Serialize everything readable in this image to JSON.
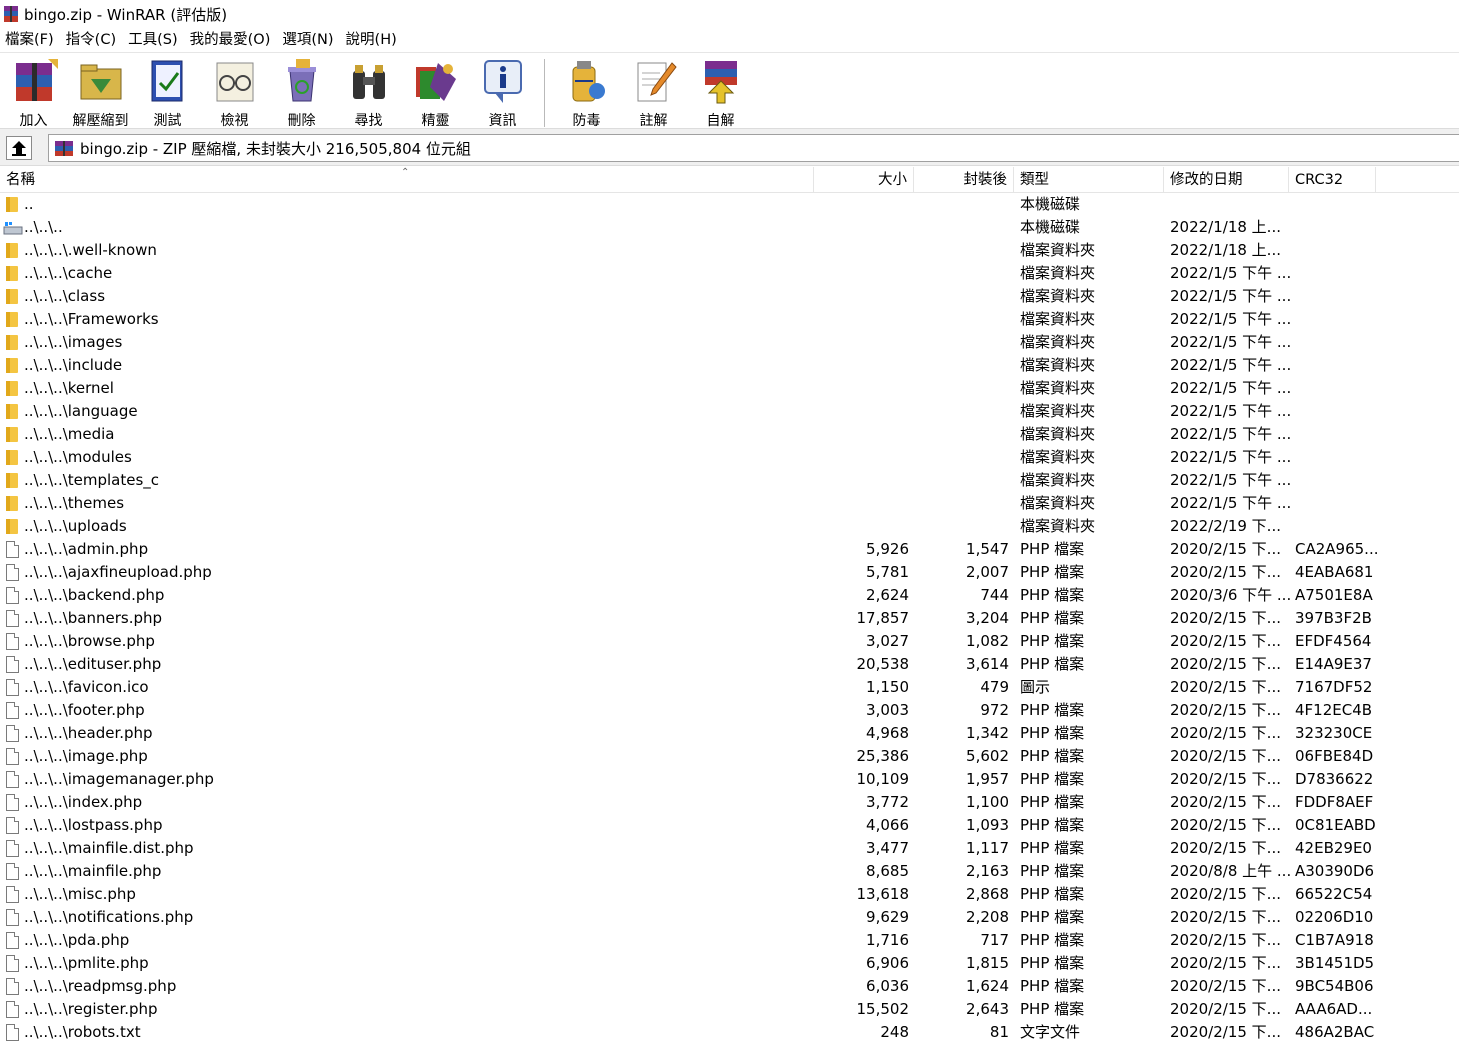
{
  "window": {
    "title": "bingo.zip - WinRAR (評估版)"
  },
  "menu": [
    "檔案(F)",
    "指令(C)",
    "工具(S)",
    "我的最愛(O)",
    "選項(N)",
    "說明(H)"
  ],
  "toolbar": {
    "add": "加入",
    "extract_to": "解壓縮到",
    "test": "測試",
    "view": "檢視",
    "delete": "刪除",
    "find": "尋找",
    "wizard": "精靈",
    "info": "資訊",
    "virus_scan": "防毒",
    "comment": "註解",
    "sfx": "自解"
  },
  "address": {
    "text": "bingo.zip - ZIP 壓縮檔, 未封裝大小 216,505,804 位元組"
  },
  "columns": {
    "name": "名稱",
    "size": "大小",
    "packed": "封裝後",
    "type": "類型",
    "modified": "修改的日期",
    "crc": "CRC32"
  },
  "rows": [
    {
      "icon": "folder",
      "name": "..",
      "size": "",
      "packed": "",
      "type": "本機磁碟",
      "date": "",
      "crc": ""
    },
    {
      "icon": "drive",
      "name": "..\\..\\..",
      "size": "",
      "packed": "",
      "type": "本機磁碟",
      "date": "2022/1/18 上...",
      "crc": ""
    },
    {
      "icon": "folder",
      "name": "..\\..\\..\\.well-known",
      "size": "",
      "packed": "",
      "type": "檔案資料夾",
      "date": "2022/1/18 上...",
      "crc": ""
    },
    {
      "icon": "folder",
      "name": "..\\..\\..\\cache",
      "size": "",
      "packed": "",
      "type": "檔案資料夾",
      "date": "2022/1/5 下午 ...",
      "crc": ""
    },
    {
      "icon": "folder",
      "name": "..\\..\\..\\class",
      "size": "",
      "packed": "",
      "type": "檔案資料夾",
      "date": "2022/1/5 下午 ...",
      "crc": ""
    },
    {
      "icon": "folder",
      "name": "..\\..\\..\\Frameworks",
      "size": "",
      "packed": "",
      "type": "檔案資料夾",
      "date": "2022/1/5 下午 ...",
      "crc": ""
    },
    {
      "icon": "folder",
      "name": "..\\..\\..\\images",
      "size": "",
      "packed": "",
      "type": "檔案資料夾",
      "date": "2022/1/5 下午 ...",
      "crc": ""
    },
    {
      "icon": "folder",
      "name": "..\\..\\..\\include",
      "size": "",
      "packed": "",
      "type": "檔案資料夾",
      "date": "2022/1/5 下午 ...",
      "crc": ""
    },
    {
      "icon": "folder",
      "name": "..\\..\\..\\kernel",
      "size": "",
      "packed": "",
      "type": "檔案資料夾",
      "date": "2022/1/5 下午 ...",
      "crc": ""
    },
    {
      "icon": "folder",
      "name": "..\\..\\..\\language",
      "size": "",
      "packed": "",
      "type": "檔案資料夾",
      "date": "2022/1/5 下午 ...",
      "crc": ""
    },
    {
      "icon": "folder",
      "name": "..\\..\\..\\media",
      "size": "",
      "packed": "",
      "type": "檔案資料夾",
      "date": "2022/1/5 下午 ...",
      "crc": ""
    },
    {
      "icon": "folder",
      "name": "..\\..\\..\\modules",
      "size": "",
      "packed": "",
      "type": "檔案資料夾",
      "date": "2022/1/5 下午 ...",
      "crc": ""
    },
    {
      "icon": "folder",
      "name": "..\\..\\..\\templates_c",
      "size": "",
      "packed": "",
      "type": "檔案資料夾",
      "date": "2022/1/5 下午 ...",
      "crc": ""
    },
    {
      "icon": "folder",
      "name": "..\\..\\..\\themes",
      "size": "",
      "packed": "",
      "type": "檔案資料夾",
      "date": "2022/1/5 下午 ...",
      "crc": ""
    },
    {
      "icon": "folder",
      "name": "..\\..\\..\\uploads",
      "size": "",
      "packed": "",
      "type": "檔案資料夾",
      "date": "2022/2/19 下...",
      "crc": ""
    },
    {
      "icon": "file",
      "name": "..\\..\\..\\admin.php",
      "size": "5,926",
      "packed": "1,547",
      "type": "PHP 檔案",
      "date": "2020/2/15 下...",
      "crc": "CA2A965..."
    },
    {
      "icon": "file",
      "name": "..\\..\\..\\ajaxfineupload.php",
      "size": "5,781",
      "packed": "2,007",
      "type": "PHP 檔案",
      "date": "2020/2/15 下...",
      "crc": "4EABA681"
    },
    {
      "icon": "file",
      "name": "..\\..\\..\\backend.php",
      "size": "2,624",
      "packed": "744",
      "type": "PHP 檔案",
      "date": "2020/3/6 下午 ...",
      "crc": "A7501E8A"
    },
    {
      "icon": "file",
      "name": "..\\..\\..\\banners.php",
      "size": "17,857",
      "packed": "3,204",
      "type": "PHP 檔案",
      "date": "2020/2/15 下...",
      "crc": "397B3F2B"
    },
    {
      "icon": "file",
      "name": "..\\..\\..\\browse.php",
      "size": "3,027",
      "packed": "1,082",
      "type": "PHP 檔案",
      "date": "2020/2/15 下...",
      "crc": "EFDF4564"
    },
    {
      "icon": "file",
      "name": "..\\..\\..\\edituser.php",
      "size": "20,538",
      "packed": "3,614",
      "type": "PHP 檔案",
      "date": "2020/2/15 下...",
      "crc": "E14A9E37"
    },
    {
      "icon": "file",
      "name": "..\\..\\..\\favicon.ico",
      "size": "1,150",
      "packed": "479",
      "type": "圖示",
      "date": "2020/2/15 下...",
      "crc": "7167DF52"
    },
    {
      "icon": "file",
      "name": "..\\..\\..\\footer.php",
      "size": "3,003",
      "packed": "972",
      "type": "PHP 檔案",
      "date": "2020/2/15 下...",
      "crc": "4F12EC4B"
    },
    {
      "icon": "file",
      "name": "..\\..\\..\\header.php",
      "size": "4,968",
      "packed": "1,342",
      "type": "PHP 檔案",
      "date": "2020/2/15 下...",
      "crc": "323230CE"
    },
    {
      "icon": "file",
      "name": "..\\..\\..\\image.php",
      "size": "25,386",
      "packed": "5,602",
      "type": "PHP 檔案",
      "date": "2020/2/15 下...",
      "crc": "06FBE84D"
    },
    {
      "icon": "file",
      "name": "..\\..\\..\\imagemanager.php",
      "size": "10,109",
      "packed": "1,957",
      "type": "PHP 檔案",
      "date": "2020/2/15 下...",
      "crc": "D7836622"
    },
    {
      "icon": "file",
      "name": "..\\..\\..\\index.php",
      "size": "3,772",
      "packed": "1,100",
      "type": "PHP 檔案",
      "date": "2020/2/15 下...",
      "crc": "FDDF8AEF"
    },
    {
      "icon": "file",
      "name": "..\\..\\..\\lostpass.php",
      "size": "4,066",
      "packed": "1,093",
      "type": "PHP 檔案",
      "date": "2020/2/15 下...",
      "crc": "0C81EABD"
    },
    {
      "icon": "file",
      "name": "..\\..\\..\\mainfile.dist.php",
      "size": "3,477",
      "packed": "1,117",
      "type": "PHP 檔案",
      "date": "2020/2/15 下...",
      "crc": "42EB29E0"
    },
    {
      "icon": "file",
      "name": "..\\..\\..\\mainfile.php",
      "size": "8,685",
      "packed": "2,163",
      "type": "PHP 檔案",
      "date": "2020/8/8 上午 ...",
      "crc": "A30390D6"
    },
    {
      "icon": "file",
      "name": "..\\..\\..\\misc.php",
      "size": "13,618",
      "packed": "2,868",
      "type": "PHP 檔案",
      "date": "2020/2/15 下...",
      "crc": "66522C54"
    },
    {
      "icon": "file",
      "name": "..\\..\\..\\notifications.php",
      "size": "9,629",
      "packed": "2,208",
      "type": "PHP 檔案",
      "date": "2020/2/15 下...",
      "crc": "02206D10"
    },
    {
      "icon": "file",
      "name": "..\\..\\..\\pda.php",
      "size": "1,716",
      "packed": "717",
      "type": "PHP 檔案",
      "date": "2020/2/15 下...",
      "crc": "C1B7A918"
    },
    {
      "icon": "file",
      "name": "..\\..\\..\\pmlite.php",
      "size": "6,906",
      "packed": "1,815",
      "type": "PHP 檔案",
      "date": "2020/2/15 下...",
      "crc": "3B1451D5"
    },
    {
      "icon": "file",
      "name": "..\\..\\..\\readpmsg.php",
      "size": "6,036",
      "packed": "1,624",
      "type": "PHP 檔案",
      "date": "2020/2/15 下...",
      "crc": "9BC54B06"
    },
    {
      "icon": "file",
      "name": "..\\..\\..\\register.php",
      "size": "15,502",
      "packed": "2,643",
      "type": "PHP 檔案",
      "date": "2020/2/15 下...",
      "crc": "AAA6AD..."
    },
    {
      "icon": "file",
      "name": "..\\..\\..\\robots.txt",
      "size": "248",
      "packed": "81",
      "type": "文字文件",
      "date": "2020/2/15 下...",
      "crc": "486A2BAC"
    }
  ]
}
